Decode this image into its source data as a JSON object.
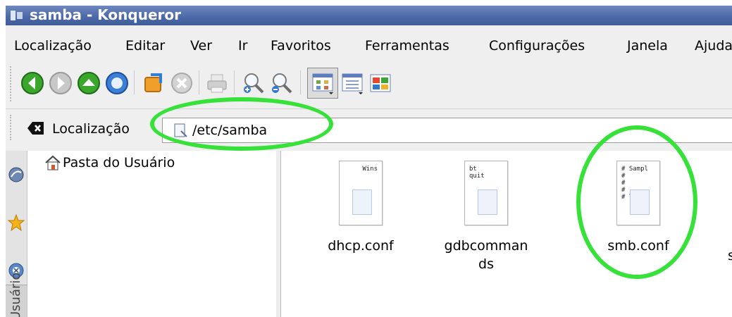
{
  "window": {
    "title": "samba - Konqueror"
  },
  "menu": [
    {
      "label": "Localização"
    },
    {
      "label": "Editar"
    },
    {
      "label": "Ver"
    },
    {
      "label": "Ir"
    },
    {
      "label": "Favoritos"
    },
    {
      "label": "Ferramentas"
    },
    {
      "label": "Configurações"
    },
    {
      "label": "Janela"
    },
    {
      "label": "Ajuda"
    }
  ],
  "toolbar": {
    "icons": [
      "back-icon",
      "forward-icon",
      "up-icon",
      "home-icon",
      "reload-icon",
      "stop-icon",
      "print-icon",
      "zoom-in-icon",
      "zoom-out-icon",
      "icon-view-icon",
      "list-view-icon",
      "split-view-icon"
    ]
  },
  "location": {
    "label": "Localização",
    "value": "/etc/samba"
  },
  "sidebar": {
    "root_label": "Pasta do Usuário",
    "vertical_tab": "Usuário"
  },
  "files": [
    {
      "name": "dhcp.conf",
      "preview": "Wins"
    },
    {
      "name": "gdbcommands",
      "preview": "bt\nquit"
    },
    {
      "name": "smb.conf",
      "preview": "# Sampl\n#\n#\n#\n# This"
    },
    {
      "name": "s",
      "preview": ""
    }
  ],
  "colors": {
    "highlight": "#36e23a",
    "titlebar": "#4b67a6"
  }
}
